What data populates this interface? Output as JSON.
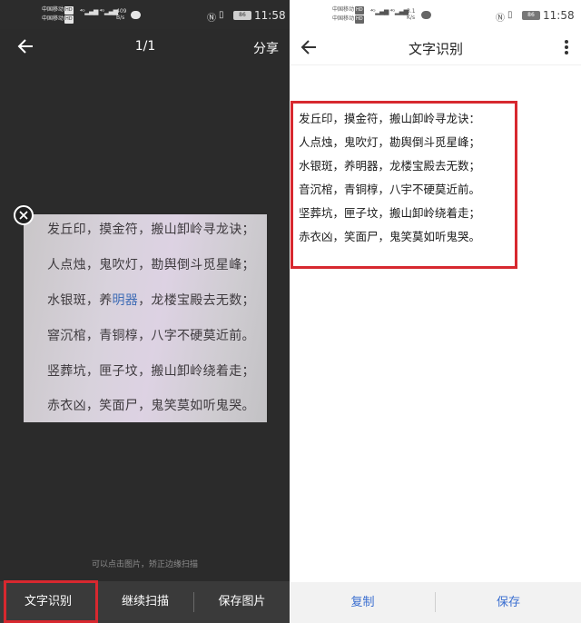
{
  "left": {
    "status": {
      "carrier1": "中国移动",
      "carrier2": "中国移动",
      "hd": "HD",
      "net_speed": "409",
      "net_unit": "B/s",
      "battery": "86",
      "time": "11:58"
    },
    "toolbar": {
      "page_indicator": "1/1",
      "share_label": "分享"
    },
    "photo_lines": [
      "发丘印，摸金符，搬山卸岭寻龙诀；",
      "人点烛，鬼吹灯，勘舆倒斗觅星峰；",
      "水银斑，养",
      "明器",
      "，龙楼宝殿去无数；",
      "窨沉棺，青铜椁，八字不硬莫近前。",
      "竖葬坑，匣子坟，搬山卸岭绕着走；",
      "赤衣凶，笑面尸，鬼笑莫如听鬼哭。"
    ],
    "hint": "可以点击图片，矫正边缘扫描",
    "bottom": {
      "ocr_label": "文字识别",
      "continue_label": "继续扫描",
      "save_image_label": "保存图片"
    }
  },
  "right": {
    "status": {
      "carrier1": "中国移动",
      "carrier2": "中国移动",
      "hd": "HD",
      "net_speed": "3.1",
      "net_unit": "K/s",
      "battery": "86",
      "time": "11:58"
    },
    "toolbar": {
      "title": "文字识别"
    },
    "ocr_lines": [
      "发丘印，摸金符，搬山卸岭寻龙诀：",
      "人点烛，鬼吹灯，勘舆倒斗觅星峰；",
      "水银斑，养明器，龙楼宝殿去无数；",
      "音沉棺，青铜椁，八宇不硬莫近前。",
      "坚葬坑，匣子坟，搬山卸岭绕着走；",
      "赤衣凶，笑面尸，鬼笑莫如听鬼哭。"
    ],
    "bottom": {
      "copy_label": "复制",
      "save_label": "保存"
    }
  },
  "colors": {
    "highlight_red": "#d7282f",
    "action_blue": "#3a6ed0",
    "dark_bg": "#2b2b2b"
  },
  "icons": [
    "back-arrow-icon",
    "close-icon",
    "more-vertical-icon",
    "message-icon",
    "nfc-icon",
    "vibrate-icon",
    "battery-icon",
    "signal-icon"
  ]
}
